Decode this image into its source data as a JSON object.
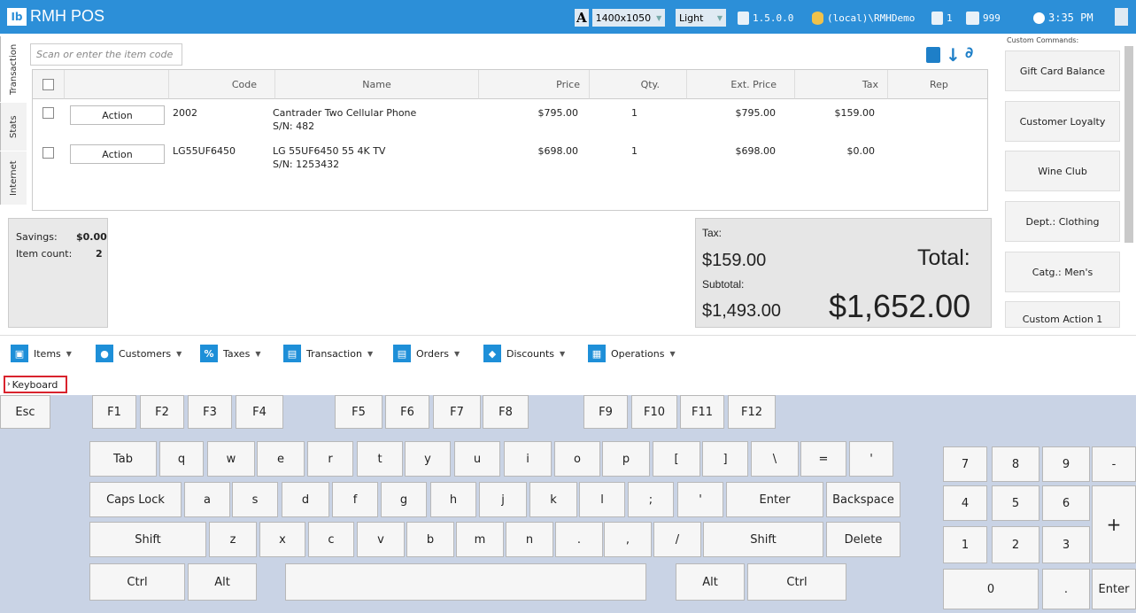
{
  "titlebar": {
    "app_name": "RMH POS",
    "logo_text": "Ib",
    "resolution": "1400x1050",
    "theme": "Light",
    "version": "1.5.0.0",
    "database": "(local)\\RMHDemo",
    "register": "1",
    "cashier": "999",
    "time": "3:35 PM"
  },
  "side_tabs": [
    "Transaction",
    "Stats",
    "Internet"
  ],
  "search": {
    "placeholder": "Scan or enter the item code"
  },
  "grid": {
    "columns": [
      "Code",
      "Name",
      "Price",
      "Qty.",
      "Ext. Price",
      "Tax",
      "Rep"
    ],
    "rows": [
      {
        "action": "Action",
        "code": "2002",
        "name": "Cantrader Two Cellular Phone",
        "serial": "S/N: 482",
        "price": "$795.00",
        "qty": "1",
        "ext_price": "$795.00",
        "tax": "$159.00"
      },
      {
        "action": "Action",
        "code": "LG55UF6450",
        "name": "LG 55UF6450 55 4K TV",
        "serial": "S/N: 1253432",
        "price": "$698.00",
        "qty": "1",
        "ext_price": "$698.00",
        "tax": "$0.00"
      }
    ]
  },
  "summary": {
    "savings_label": "Savings:",
    "savings_value": "$0.00",
    "count_label": "Item count:",
    "count_value": "2",
    "tax_label": "Tax:",
    "tax_value": "$159.00",
    "subtotal_label": "Subtotal:",
    "subtotal_value": "$1,493.00",
    "total_label": "Total:",
    "total_value": "$1,652.00"
  },
  "custom_commands": {
    "header": "Custom Commands:",
    "items": [
      "Gift Card Balance",
      "Customer Loyalty",
      "Wine Club",
      "Dept.: Clothing",
      "Catg.: Men's",
      "Custom Action 1"
    ]
  },
  "menu": [
    "Items",
    "Customers",
    "Taxes",
    "Transaction",
    "Orders",
    "Discounts",
    "Operations"
  ],
  "keyboard": {
    "label": "Keyboard",
    "esc": "Esc",
    "fkeys": [
      "F1",
      "F2",
      "F3",
      "F4",
      "F5",
      "F6",
      "F7",
      "F8",
      "F9",
      "F10",
      "F11",
      "F12"
    ],
    "row1": [
      "Tab",
      "q",
      "w",
      "e",
      "r",
      "t",
      "y",
      "u",
      "i",
      "o",
      "p",
      "[",
      "]",
      "\\",
      "=",
      "'"
    ],
    "row2": [
      "Caps Lock",
      "a",
      "s",
      "d",
      "f",
      "g",
      "h",
      "j",
      "k",
      "l",
      ";",
      "'",
      "Enter",
      "Backspace"
    ],
    "row3": [
      "Shift",
      "z",
      "x",
      "c",
      "v",
      "b",
      "m",
      "n",
      ".",
      ",",
      "/",
      "Shift",
      "Delete"
    ],
    "row4": [
      "Ctrl",
      "Alt",
      "",
      "Alt",
      "Ctrl"
    ],
    "numpad": [
      "7",
      "8",
      "9",
      "-",
      "4",
      "5",
      "6",
      "+",
      "1",
      "2",
      "3",
      "0",
      ".",
      "Enter"
    ]
  },
  "colors": {
    "titlebar": "#2c8fd8",
    "keyboard_bg": "#c9d3e5",
    "highlight": "#d9232d"
  }
}
